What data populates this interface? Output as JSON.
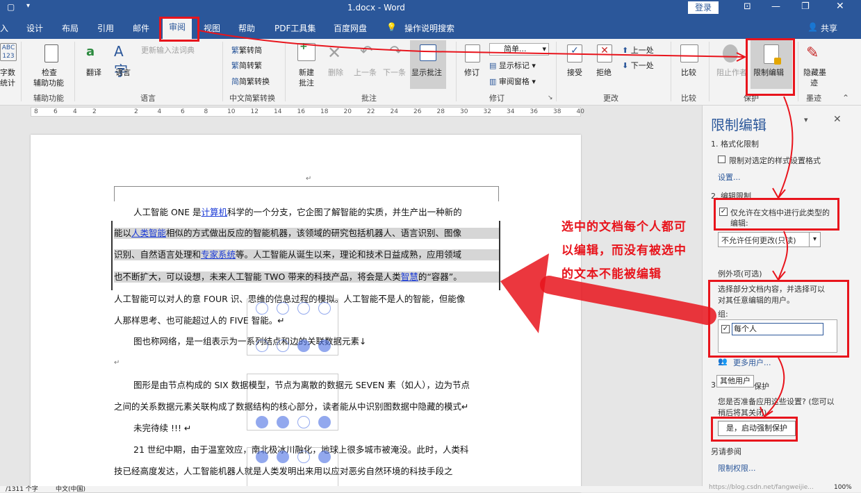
{
  "window": {
    "title": "1.docx - Word",
    "login": "登录"
  },
  "menu": {
    "items": [
      "入",
      "设计",
      "布局",
      "引用",
      "邮件",
      "审阅",
      "视图",
      "帮助",
      "PDF工具集",
      "百度网盘"
    ],
    "search": "操作说明搜索",
    "share": "共享"
  },
  "ribbon": {
    "wordcount": [
      "字数",
      "统计"
    ],
    "check": "检查",
    "access": "辅助功能",
    "access_group": "辅助功能",
    "translate": "翻译",
    "language": "语言",
    "update_ime": "更新输入法词典",
    "lang_group": "语言",
    "t2s": "繁转简",
    "s2t": "简转繁",
    "tsconv": "简繁转换",
    "chinese_group": "中文简繁转换",
    "new_comment": "新建",
    "new_comment2": "批注",
    "delete": "删除",
    "prev": "上一条",
    "next": "下一条",
    "show_comments": "显示批注",
    "comments_group": "批注",
    "track": "修订",
    "simple": "简单...",
    "show_markup": "显示标记",
    "review_pane": "审阅窗格",
    "track_group": "修订",
    "accept": "接受",
    "reject": "拒绝",
    "prev_change": "上一处",
    "next_change": "下一处",
    "changes_group": "更改",
    "compare": "比较",
    "compare_group": "比较",
    "block_authors": "阻止作者",
    "restrict": "限制编辑",
    "protect_group": "保护",
    "hide_ink": "隐藏墨",
    "hide_ink2": "迹",
    "ink_group": "墨迹"
  },
  "ruler": {
    "ticks": [
      "8",
      "6",
      "4",
      "2",
      "2",
      "4",
      "6",
      "8",
      "10",
      "12",
      "14",
      "16",
      "18",
      "20",
      "22",
      "24",
      "26",
      "28",
      "30",
      "32",
      "34",
      "36",
      "38",
      "40"
    ]
  },
  "doc": {
    "l1a": "人工智能 ONE 是",
    "l1b": "计算机",
    "l1c": "科学的一个分支，它企图了解智能的实质，并生产出一种新的",
    "l2a": "能以",
    "l2b": "人类智能",
    "l2c": "相似的方式做出反应的智能机器，该领域的研究包括机器人、语言识别、图像",
    "l3a": "识别、自然语言处理和",
    "l3b": "专家系统",
    "l3c": "等。人工智能从诞生以来，理论和技术日益成熟，应用领域",
    "l4a": "也不断扩大，可以设想，未来人工智能 TWO 带来的科技产品，将会是人类",
    "l4b": "智慧",
    "l4c": "的“容器”。",
    "l5": "人工智能可以对人的意 FOUR 识、思维的信息过程的模拟。人工智能不是人的智能，但能像",
    "l6": "人那样思考、也可能超过人的 FIVE 智能。↵",
    "l7": "图也称网络，是一组表示为一系列结点和边的关联数据元素↓",
    "l8": "↵",
    "l9": "图形是由节点构成的 SIX 数据模型，节点为离散的数据元 SEVEN 素（如人），边为节点",
    "l10": "之间的关系数据元素关联构成了数据结构的核心部分，读者能从中识别图数据中隐藏的模式↵",
    "l11": "未完待续 !!! ↵",
    "l12": "21 世纪中期，由于温室效应，南北极冰川融化，地球上很多城市被淹没。此时，人类科",
    "l13": "技已经高度发达，人工智能机器人就是人类发明出来用以应对恶劣自然环境的科技手段之"
  },
  "pane": {
    "title": "限制编辑",
    "s1": "1. 格式化限制",
    "fmt_cb": "限制对选定的样式设置格式",
    "settings": "设置...",
    "s2": "2. 编辑限制",
    "edit_cb1": "仅允许在文档中进行此类型的",
    "edit_cb2": "编辑:",
    "edit_type": "不允许任何更改(只读)",
    "exceptions": "例外项(可选)",
    "ex_desc1": "选择部分文档内容，并选择可以",
    "ex_desc2": "对其任意编辑的用户。",
    "groups": "组:",
    "everyone": "每个人",
    "more_users": "更多用户...",
    "s3": "3.",
    "other_users": "其他用户",
    "s3_tail": "保护",
    "apply_q1": "您是否准备应用这些设置? (您可以",
    "apply_q2": "稍后将其关闭)",
    "start": "是，启动强制保护",
    "see_also": "另请参阅",
    "perm": "限制权限..."
  },
  "annotation": {
    "l1": "选中的文档每个人都可",
    "l2": "以编辑，而没有被选中",
    "l3": "的文本不能被编辑"
  },
  "status": {
    "words": "/1311 个字",
    "lang": "中文(中国)",
    "zoom": "100%",
    "watermark": "https://blog.csdn.net/fangweijie..."
  },
  "colors": {
    "accent": "#2b579a",
    "annotation": "#e8141c"
  }
}
